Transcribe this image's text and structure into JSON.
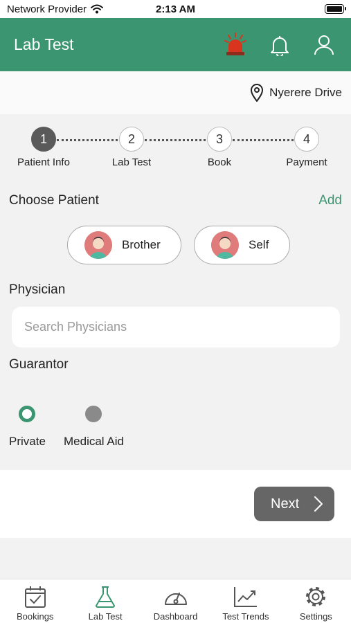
{
  "status_bar": {
    "carrier": "Network Provider",
    "time": "2:13 AM"
  },
  "header": {
    "title": "Lab Test"
  },
  "location": {
    "name": "Nyerere Drive"
  },
  "stepper": {
    "steps": [
      {
        "number": "1",
        "label": "Patient Info"
      },
      {
        "number": "2",
        "label": "Lab Test"
      },
      {
        "number": "3",
        "label": "Book"
      },
      {
        "number": "4",
        "label": "Payment"
      }
    ],
    "active_step": 1
  },
  "choose_patient": {
    "title": "Choose Patient",
    "add_label": "Add",
    "patients": [
      {
        "name": "Brother"
      },
      {
        "name": "Self"
      }
    ]
  },
  "physician": {
    "title": "Physician",
    "placeholder": "Search Physicians",
    "value": ""
  },
  "guarantor": {
    "title": "Guarantor",
    "options": [
      {
        "label": "Private",
        "selected": true
      },
      {
        "label": "Medical Aid",
        "selected": false
      }
    ]
  },
  "next_button": {
    "label": "Next"
  },
  "tab_bar": {
    "tabs": [
      {
        "label": "Bookings",
        "icon": "calendar-check-icon"
      },
      {
        "label": "Lab Test",
        "icon": "flask-icon",
        "active": true
      },
      {
        "label": "Dashboard",
        "icon": "gauge-icon"
      },
      {
        "label": "Test Trends",
        "icon": "trend-chart-icon"
      },
      {
        "label": "Settings",
        "icon": "gear-icon"
      }
    ]
  },
  "colors": {
    "primary": "#3a9570",
    "alarm": "#d9341e",
    "button": "#666666"
  }
}
